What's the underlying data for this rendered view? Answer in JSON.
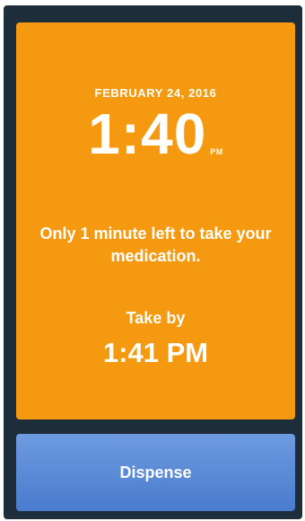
{
  "alert": {
    "date": "FEBRUARY 24, 2016",
    "time": "1:40",
    "meridiem": "PM",
    "message": "Only 1 minute left to take your medication.",
    "take_by_label": "Take by",
    "take_by_time": "1:41 PM"
  },
  "actions": {
    "dispense_label": "Dispense"
  },
  "colors": {
    "alert_background": "#f59a10",
    "frame_background": "#1d2d3a",
    "button_background": "#5a89d6",
    "text": "#ffffff"
  }
}
